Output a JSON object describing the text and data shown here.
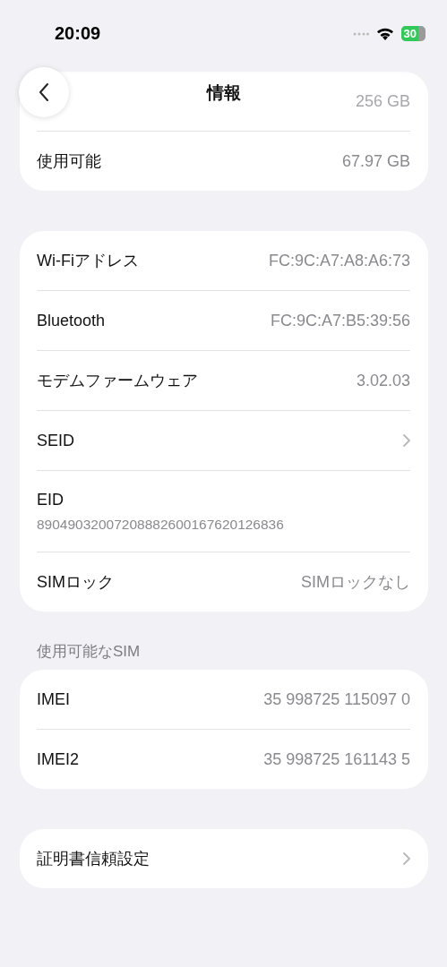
{
  "status_bar": {
    "time": "20:09",
    "battery": "30"
  },
  "nav": {
    "title": "情報"
  },
  "sections": [
    {
      "rows": [
        {
          "kind": "obscured",
          "value": "256 GB"
        },
        {
          "kind": "value",
          "label": "使用可能",
          "value": "67.97 GB"
        }
      ]
    },
    {
      "rows": [
        {
          "kind": "value",
          "label": "Wi-Fiアドレス",
          "value": "FC:9C:A7:A8:A6:73"
        },
        {
          "kind": "value",
          "label": "Bluetooth",
          "value": "FC:9C:A7:B5:39:56"
        },
        {
          "kind": "value",
          "label": "モデムファームウェア",
          "value": "3.02.03"
        },
        {
          "kind": "link",
          "label": "SEID"
        },
        {
          "kind": "stacked",
          "label": "EID",
          "value": "89049032007208882600167620126836"
        },
        {
          "kind": "value",
          "label": "SIMロック",
          "value": "SIMロックなし"
        }
      ]
    },
    {
      "header": "使用可能なSIM",
      "rows": [
        {
          "kind": "value",
          "label": "IMEI",
          "value": "35 998725 115097 0"
        },
        {
          "kind": "value",
          "label": "IMEI2",
          "value": "35 998725 161143 5"
        }
      ]
    },
    {
      "rows": [
        {
          "kind": "link",
          "label": "証明書信頼設定"
        }
      ]
    }
  ]
}
